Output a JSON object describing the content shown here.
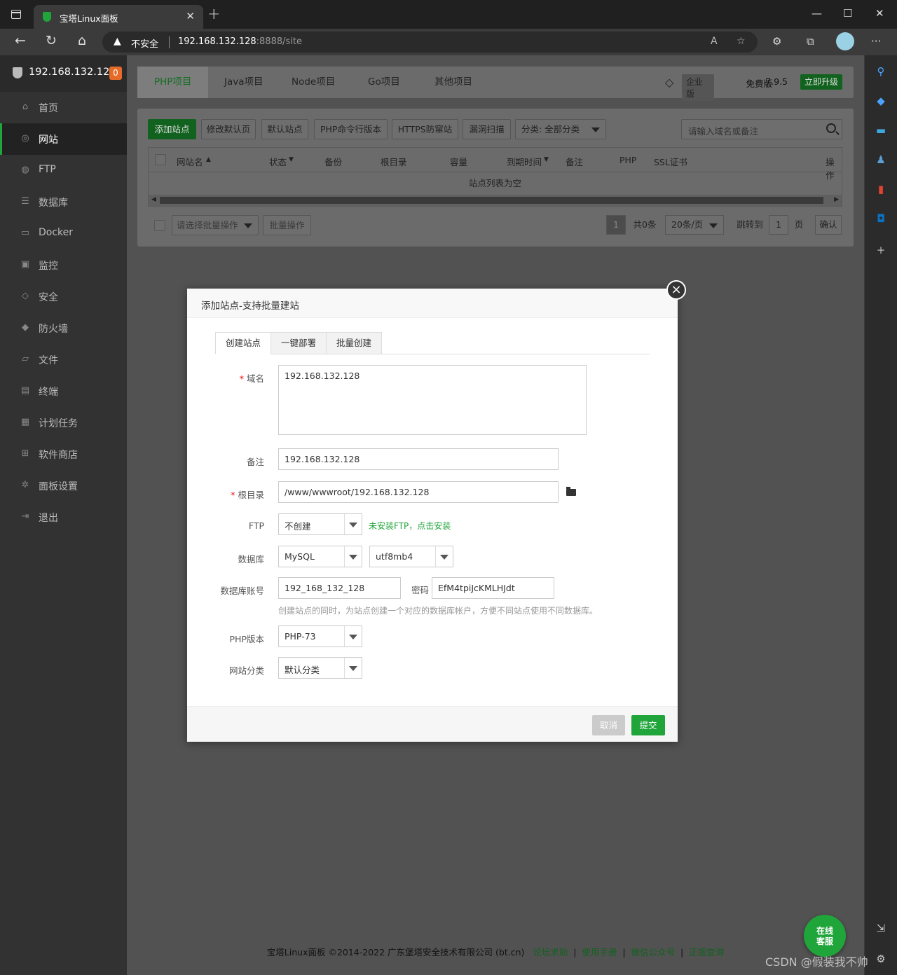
{
  "browser": {
    "tab_title": "宝塔Linux面板",
    "tab_close": "✕",
    "new_tab": "+",
    "insecure_label": "不安全",
    "url_host": "192.168.132.128",
    "url_path": ":8888/site"
  },
  "sidebar": {
    "server_ip": "192.168.132.128",
    "badge_count": "0",
    "items": [
      {
        "label": "首页",
        "icon": "home-icon"
      },
      {
        "label": "网站",
        "icon": "globe-icon"
      },
      {
        "label": "FTP",
        "icon": "ftp-icon"
      },
      {
        "label": "数据库",
        "icon": "database-icon"
      },
      {
        "label": "Docker",
        "icon": "docker-icon"
      },
      {
        "label": "监控",
        "icon": "monitor-icon"
      },
      {
        "label": "安全",
        "icon": "shield-icon"
      },
      {
        "label": "防火墙",
        "icon": "firewall-icon"
      },
      {
        "label": "文件",
        "icon": "folder-icon"
      },
      {
        "label": "终端",
        "icon": "terminal-icon"
      },
      {
        "label": "计划任务",
        "icon": "calendar-icon"
      },
      {
        "label": "软件商店",
        "icon": "grid-icon"
      },
      {
        "label": "面板设置",
        "icon": "gear-icon"
      },
      {
        "label": "退出",
        "icon": "logout-icon"
      }
    ]
  },
  "top_tabs": [
    "PHP项目",
    "Java项目",
    "Node项目",
    "Go项目",
    "其他项目"
  ],
  "version": {
    "enterprise": "企业版",
    "free": "免费版",
    "number": "7.9.5",
    "upgrade": "立即升级"
  },
  "toolbar": {
    "add_site": "添加站点",
    "edit_default_page": "修改默认页",
    "default_site": "默认站点",
    "php_cli": "PHP命令行版本",
    "https_protect": "HTTPS防窜站",
    "vuln_scan": "漏洞扫描",
    "category": "分类: 全部分类",
    "search_placeholder": "请输入域名或备注"
  },
  "table": {
    "headers": [
      "网站名",
      "状态",
      "备份",
      "根目录",
      "容量",
      "到期时间",
      "备注",
      "PHP",
      "SSL证书",
      "操作"
    ],
    "empty_text": "站点列表为空"
  },
  "batch": {
    "select_placeholder": "请选择批量操作",
    "batch_button": "批量操作"
  },
  "pager": {
    "current": "1",
    "total": "共0条",
    "per_page": "20条/页",
    "jump_to": "跳转到",
    "page_input": "1",
    "page_unit": "页",
    "confirm": "确认"
  },
  "footer": {
    "copyright": "宝塔Linux面板 ©2014-2022 广东堡塔安全技术有限公司 (bt.cn)",
    "links": [
      "论坛求助",
      "使用手册",
      "微信公众号",
      "正版查询"
    ]
  },
  "chat": {
    "line1": "在线",
    "line2": "客服"
  },
  "watermark": "CSDN @假装我不帅",
  "modal": {
    "title": "添加站点-支持批量建站",
    "tabs": [
      "创建站点",
      "一键部署",
      "批量创建"
    ],
    "fields": {
      "domain_label": "域名",
      "domain_value": "192.168.132.128",
      "remark_label": "备注",
      "remark_value": "192.168.132.128",
      "root_label": "根目录",
      "root_value": "/www/wwwroot/192.168.132.128",
      "ftp_label": "FTP",
      "ftp_value": "不创建",
      "ftp_help": "未安装FTP，点击安装",
      "db_label": "数据库",
      "db_type": "MySQL",
      "db_charset": "utf8mb4",
      "db_account_label": "数据库账号",
      "db_account_value": "192_168_132_128",
      "password_label": "密码",
      "password_value": "EfM4tpiJcKMLHJdt",
      "db_help": "创建站点的同时，为站点创建一个对应的数据库帐户，方便不同站点使用不同数据库。",
      "php_label": "PHP版本",
      "php_value": "PHP-73",
      "category_label": "网站分类",
      "category_value": "默认分类"
    },
    "cancel": "取消",
    "submit": "提交"
  }
}
